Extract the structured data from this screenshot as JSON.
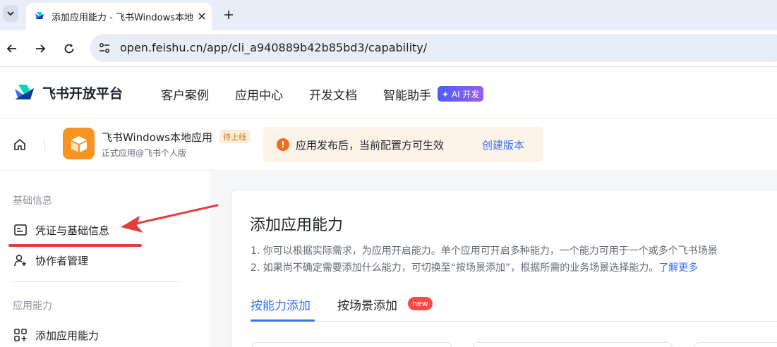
{
  "browser": {
    "tab_title": "添加应用能力 - 飞书Windows本地",
    "url": "open.feishu.cn/app/cli_a940889b42b85bd3/capability/",
    "icons": [
      "chevron-down-icon",
      "close-icon",
      "plus-icon",
      "back-icon",
      "forward-icon",
      "reload-icon",
      "site-info-icon"
    ]
  },
  "topnav": {
    "brand": "飞书开放平台",
    "items": [
      "客户案例",
      "应用中心",
      "开发文档",
      "智能助手"
    ],
    "ai_badge": "✦ AI 开发"
  },
  "app_header": {
    "app_name": "飞书Windows本地应用",
    "status_tag": "待上线",
    "app_subtitle": "正式应用@飞书个人版",
    "notice_text": "应用发布后，当前配置方可生效",
    "notice_link": "创建版本"
  },
  "sidebar": {
    "group1": "基础信息",
    "item_credentials": "凭证与基础信息",
    "item_collaborators": "协作者管理",
    "group2": "应用能力",
    "item_add_capability": "添加应用能力"
  },
  "main": {
    "title": "添加应用能力",
    "desc1": "1. 你可以根据实际需求，为应用开启能力。单个应用可开启多种能力，一个能力可用于一个或多个飞书场景",
    "desc2": "2. 如果尚不确定需要添加什么能力，可切换至“按场景添加”，根据所需的业务场景选择能力。",
    "desc2_link": "了解更多",
    "tab_by_capability": "按能力添加",
    "tab_by_scenario": "按场景添加",
    "new_badge": "new"
  },
  "colors": {
    "accent": "#3370ff",
    "annotation_red": "#e43d3d",
    "warning_orange": "#f26c1f",
    "app_icon_orange": "#f7931e"
  }
}
